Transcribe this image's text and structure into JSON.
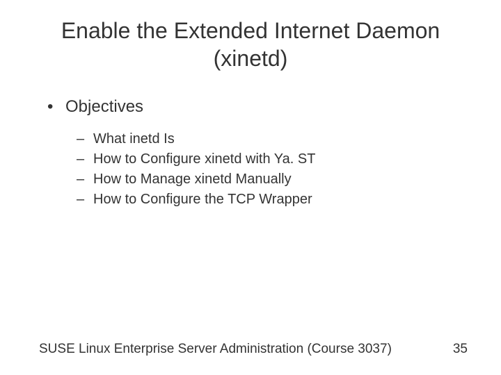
{
  "title_line1": "Enable the Extended Internet Daemon",
  "title_line2": "(xinetd)",
  "section": {
    "label": "Objectives"
  },
  "objectives": {
    "items": [
      {
        "text": "What inetd Is"
      },
      {
        "text": "How to Configure xinetd with Ya. ST"
      },
      {
        "text": "How to Manage xinetd Manually"
      },
      {
        "text": "How to Configure the TCP Wrapper"
      }
    ]
  },
  "footer": {
    "course": "SUSE Linux Enterprise Server Administration (Course 3037)",
    "page": "35"
  },
  "markers": {
    "dot": "•",
    "dash": "–"
  }
}
